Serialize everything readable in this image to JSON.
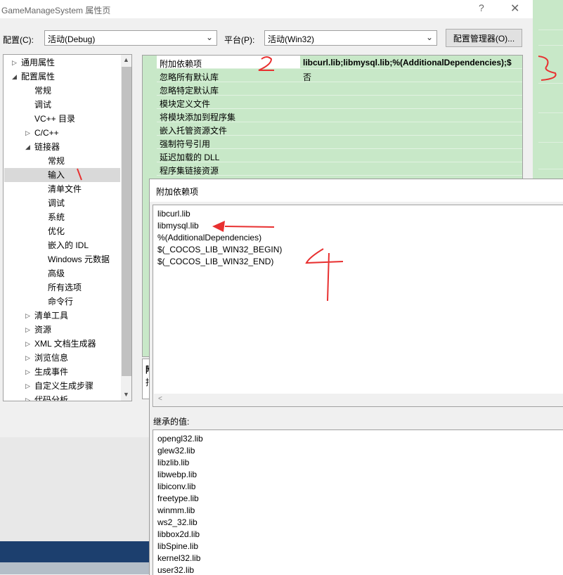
{
  "window": {
    "title": "GameManageSystem 属性页",
    "help_glyph": "?",
    "close_glyph": "✕"
  },
  "config_bar": {
    "config_label": "配置(C):",
    "config_value": "活动(Debug)",
    "platform_label": "平台(P):",
    "platform_value": "活动(Win32)",
    "manager_button": "配置管理器(O)..."
  },
  "tree": {
    "items": [
      {
        "label": "通用属性",
        "twisty": "▷"
      },
      {
        "label": "配置属性",
        "twisty": "◢"
      },
      {
        "label": "常规",
        "twisty": ""
      },
      {
        "label": "调试",
        "twisty": ""
      },
      {
        "label": "VC++ 目录",
        "twisty": ""
      },
      {
        "label": "C/C++",
        "twisty": "▷"
      },
      {
        "label": "链接器",
        "twisty": "◢"
      },
      {
        "label": "常规",
        "twisty": ""
      },
      {
        "label": "输入",
        "twisty": ""
      },
      {
        "label": "清单文件",
        "twisty": ""
      },
      {
        "label": "调试",
        "twisty": ""
      },
      {
        "label": "系统",
        "twisty": ""
      },
      {
        "label": "优化",
        "twisty": ""
      },
      {
        "label": "嵌入的 IDL",
        "twisty": ""
      },
      {
        "label": "Windows 元数据",
        "twisty": ""
      },
      {
        "label": "高级",
        "twisty": ""
      },
      {
        "label": "所有选项",
        "twisty": ""
      },
      {
        "label": "命令行",
        "twisty": ""
      },
      {
        "label": "清单工具",
        "twisty": "▷"
      },
      {
        "label": "资源",
        "twisty": "▷"
      },
      {
        "label": "XML 文档生成器",
        "twisty": "▷"
      },
      {
        "label": "浏览信息",
        "twisty": "▷"
      },
      {
        "label": "生成事件",
        "twisty": "▷"
      },
      {
        "label": "自定义生成步骤",
        "twisty": "▷"
      },
      {
        "label": "代码分析",
        "twisty": "▷"
      }
    ],
    "selected": "输入"
  },
  "grid": {
    "rows": [
      {
        "name": "附加依赖项",
        "value": "libcurl.lib;libmysql.lib;%(AdditionalDependencies);$"
      },
      {
        "name": "忽略所有默认库",
        "value": "否"
      },
      {
        "name": "忽略特定默认库",
        "value": ""
      },
      {
        "name": "模块定义文件",
        "value": ""
      },
      {
        "name": "将模块添加到程序集",
        "value": ""
      },
      {
        "name": "嵌入托管资源文件",
        "value": ""
      },
      {
        "name": "强制符号引用",
        "value": ""
      },
      {
        "name": "延迟加载的 DLL",
        "value": ""
      },
      {
        "name": "程序集链接资源",
        "value": ""
      }
    ],
    "desc_partial": [
      "附",
      "指"
    ]
  },
  "popup": {
    "title": "附加依赖项",
    "edit_lines": [
      "libcurl.lib",
      "libmysql.lib",
      "%(AdditionalDependencies)",
      "$(_COCOS_LIB_WIN32_BEGIN)",
      "$(_COCOS_LIB_WIN32_END)"
    ],
    "inherited_label": "继承的值:",
    "inherited_lines": [
      "opengl32.lib",
      "glew32.lib",
      "libzlib.lib",
      "libwebp.lib",
      "libiconv.lib",
      "freetype.lib",
      "winmm.lib",
      "ws2_32.lib",
      "libbox2d.lib",
      "libSpine.lib",
      "kernel32.lib",
      "user32.lib"
    ]
  },
  "annotations": {
    "color": "#e83030",
    "mark_1": "1",
    "mark_2": "2",
    "mark_3": "3",
    "mark_4": "4"
  },
  "colors": {
    "grid_bg": "#c8e8c8",
    "selected_row": "#d9d9d9",
    "dark_band": "#1c3f6e"
  }
}
